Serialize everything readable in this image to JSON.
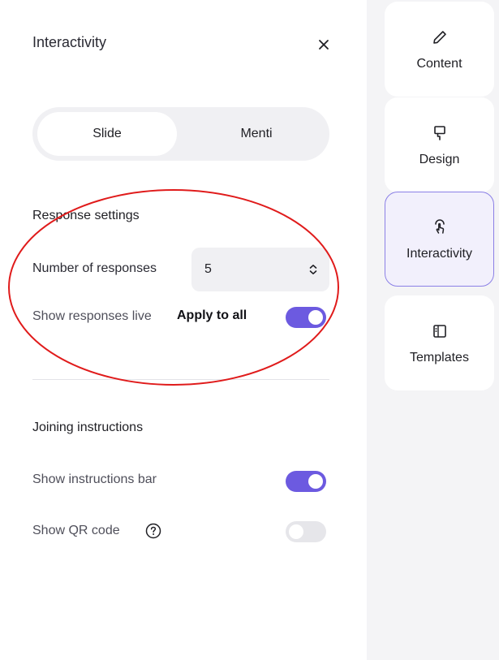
{
  "panel": {
    "title": "Interactivity",
    "close_icon": "close-icon",
    "tabs": [
      {
        "label": "Slide",
        "active": true
      },
      {
        "label": "Menti",
        "active": false
      }
    ],
    "response_settings": {
      "heading": "Response settings",
      "number_of_responses": {
        "label": "Number of responses",
        "value": "5",
        "icon": "up-down-chevron-icon"
      },
      "show_responses_live": {
        "label": "Show responses live",
        "apply_to_all": "Apply to all",
        "enabled": true
      }
    },
    "joining_instructions": {
      "heading": "Joining instructions",
      "show_instructions_bar": {
        "label": "Show instructions bar",
        "enabled": true
      },
      "show_qr_code": {
        "label": "Show QR code",
        "help_icon": "question-circle-icon",
        "enabled": false
      }
    }
  },
  "rail": {
    "items": [
      {
        "label": "Content",
        "icon": "pencil-icon",
        "active": false
      },
      {
        "label": "Design",
        "icon": "paint-roller-icon",
        "active": false
      },
      {
        "label": "Interactivity",
        "icon": "touch-icon",
        "active": true
      },
      {
        "label": "Templates",
        "icon": "layout-icon",
        "active": false
      }
    ]
  },
  "colors": {
    "accent": "#6c5ae0",
    "annotation": "#e01b1b",
    "active_border": "#8b80e6",
    "rail_background": "#f4f4f6"
  }
}
